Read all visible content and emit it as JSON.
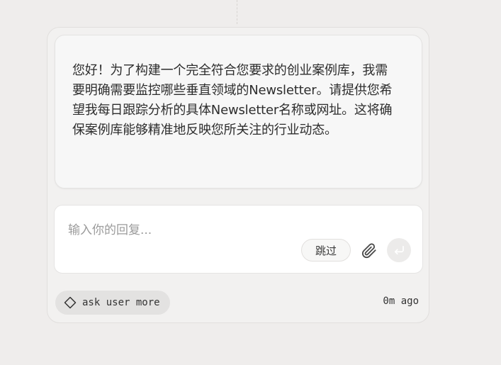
{
  "message": {
    "text": "您好！为了构建一个完全符合您要求的创业案例库，我需要明确需要监控哪些垂直领域的Newsletter。请提供您希望我每日跟踪分析的具体Newsletter名称或网址。这将确保案例库能够精准地反映您所关注的行业动态。"
  },
  "reply": {
    "placeholder": "输入你的回复...",
    "value": "",
    "skip_label": "跳过",
    "attach_icon": "paperclip-icon",
    "send_icon": "enter-arrow-icon"
  },
  "footer": {
    "tool_label": "ask user more",
    "tool_icon": "diamond-icon",
    "timestamp": "0m ago"
  }
}
